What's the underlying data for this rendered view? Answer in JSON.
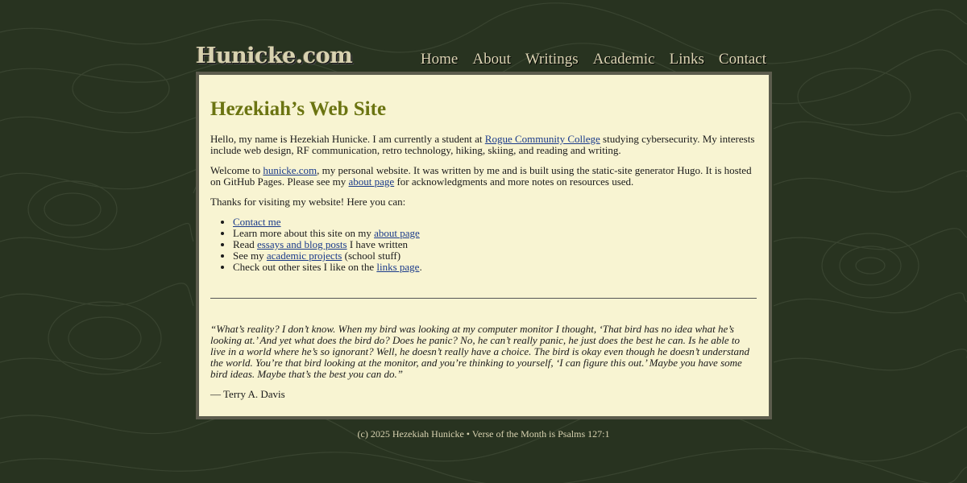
{
  "site": {
    "logo": "Hunicke.com",
    "nav": [
      "Home",
      "About",
      "Writings",
      "Academic",
      "Links",
      "Contact"
    ]
  },
  "main": {
    "title": "Hezekiah’s Web Site",
    "intro": {
      "pre": "Hello, my name is Hezekiah Hunicke. I am currently a student at ",
      "link": "Rogue Community College",
      "post": " studying cybersecurity. My interests include web design, RF communication, retro technology, hiking, skiing, and reading and writing."
    },
    "welcome": {
      "pre": "Welcome to ",
      "link1": "hunicke.com",
      "mid": ", my personal website. It was written by me and is built using the static-site generator Hugo. It is hosted on GitHub Pages. Please see my ",
      "link2": "about page",
      "post": " for acknowledgments and more notes on resources used."
    },
    "thanks": "Thanks for visiting my website! Here you can:",
    "list": [
      {
        "pre": "",
        "link": "Contact me",
        "post": ""
      },
      {
        "pre": "Learn more about this site on my ",
        "link": "about page",
        "post": ""
      },
      {
        "pre": "Read ",
        "link": "essays and blog posts",
        "post": " I have written"
      },
      {
        "pre": "See my ",
        "link": "academic projects",
        "post": " (school stuff)"
      },
      {
        "pre": "Check out other sites I like on the ",
        "link": "links page",
        "post": "."
      }
    ],
    "quote": "“What’s reality? I don’t know. When my bird was looking at my computer monitor I thought, ‘That bird has no idea what he’s looking at.’ And yet what does the bird do? Does he panic? No, he can’t really panic, he just does the best he can. Is he able to live in a world where he’s so ignorant? Well, he doesn’t really have a choice. The bird is okay even though he doesn’t understand the world. You’re that bird looking at the monitor, and you’re thinking to yourself, ‘I can figure this out.’ Maybe you have some bird ideas. Maybe that’s the best you can do.”",
    "attribution": "— Terry A. Davis"
  },
  "footer": {
    "text": "(c) 2025 Hezekiah Hunicke • Verse of the Month is Psalms 127:1"
  },
  "colors": {
    "background": "#283320",
    "panel": "#f8f4d2",
    "title": "#6b7411",
    "link": "#1a3a8a"
  }
}
